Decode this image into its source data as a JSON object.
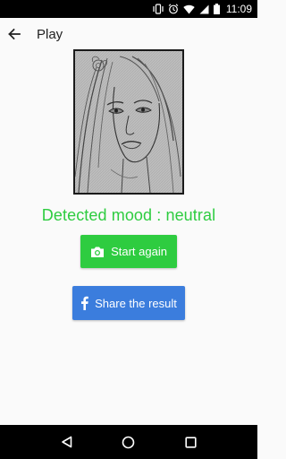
{
  "status_bar": {
    "time": "11:09",
    "icons": [
      "vibrate-icon",
      "alarm-icon",
      "wifi-icon",
      "signal-icon",
      "battery-icon"
    ]
  },
  "app_bar": {
    "title": "Play",
    "back_icon": "arrow-back-icon"
  },
  "result": {
    "mood_label": "Detected mood : neutral"
  },
  "actions": {
    "start_again_label": "Start again",
    "start_again_icon": "camera-icon",
    "share_label": "Share the result",
    "share_icon": "facebook-icon"
  },
  "nav_bar": {
    "icons": [
      "back-triangle-icon",
      "home-circle-icon",
      "recents-square-icon"
    ]
  },
  "colors": {
    "accent_green": "#2ecc40",
    "facebook_blue": "#3b7ddd",
    "background": "#fafafa"
  }
}
